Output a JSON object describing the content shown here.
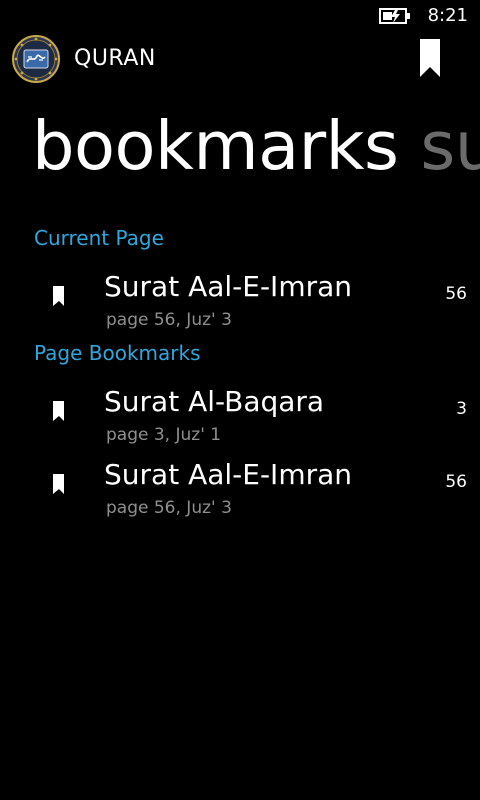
{
  "status_bar": {
    "battery_icon": "battery-charging-icon",
    "time": "8:21"
  },
  "app": {
    "logo_icon": "quran-logo-icon",
    "title": "QURAN",
    "header_icon": "bookmark-icon"
  },
  "pivot": {
    "active": "bookmarks",
    "next": "su"
  },
  "sections": {
    "current": {
      "header": "Current Page",
      "items": [
        {
          "icon": "bookmark-icon",
          "title": "Surat Aal-E-Imran",
          "subtitle": "page 56, Juz' 3",
          "page": "56"
        }
      ]
    },
    "bookmarks": {
      "header": "Page Bookmarks",
      "items": [
        {
          "icon": "bookmark-icon",
          "title": "Surat Al-Baqara",
          "subtitle": "page 3, Juz' 1",
          "page": "3"
        },
        {
          "icon": "bookmark-icon",
          "title": "Surat Aal-E-Imran",
          "subtitle": "page 56, Juz' 3",
          "page": "56"
        }
      ]
    }
  },
  "colors": {
    "background": "#000000",
    "accent": "#2fa7dd",
    "subtle_text": "#8f8f8f",
    "pivot_inactive": "#6b6b6b"
  }
}
